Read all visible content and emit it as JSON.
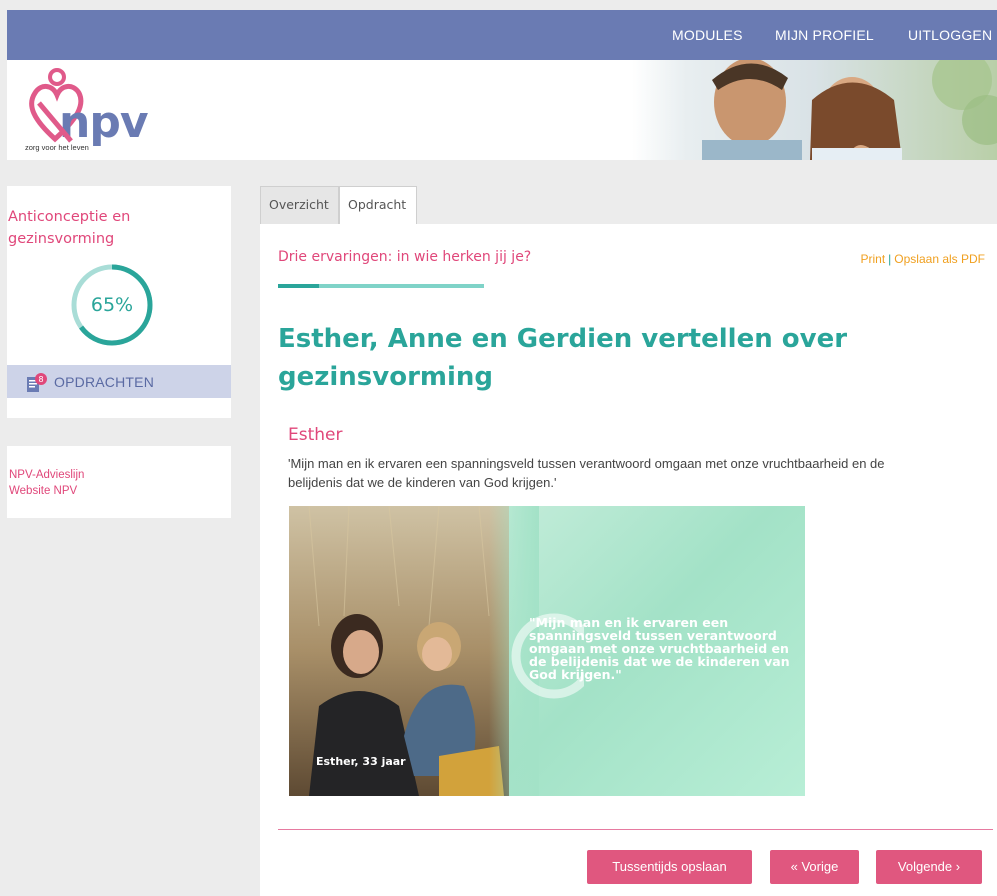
{
  "nav": {
    "modules": "MODULES",
    "profile": "MIJN PROFIEL",
    "logout": "UITLOGGEN"
  },
  "header": {
    "logo_text": "npv",
    "logo_tagline": "zorg voor het leven"
  },
  "sidebar": {
    "module_title": "Anticonceptie en gezinsvorming",
    "progress_percent": 65,
    "progress_label": "65%",
    "opdrachten_label": "OPDRACHTEN",
    "opdrachten_badge": "8",
    "links": [
      "NPV-Advieslijn",
      "Website NPV"
    ]
  },
  "tabs": [
    "Overzicht",
    "Opdracht"
  ],
  "main": {
    "exercise_title": "Drie ervaringen: in wie herken jij je?",
    "print_label": "Print",
    "pdf_label": "Opslaan als PDF",
    "step_progress": 0.2,
    "heading": "Esther, Anne en Gerdien vertellen over gezinsvorming",
    "person_name": "Esther",
    "quote": "'Mijn man en ik ervaren een spanningsveld tussen verantwoord omgaan met onze vruchtbaarheid en de belijdenis dat we de kinderen van God krijgen.'",
    "photo_quote": "\"Mijn man en ik ervaren een spanningsveld tussen verantwoord omgaan met onze vruchtbaarheid en de belijdenis dat we de kinderen van God krijgen.\"",
    "photo_caption": "Esther, 33 jaar"
  },
  "buttons": {
    "save": "Tussentijds opslaan",
    "prev": "« Vorige",
    "next": "Volgende ›"
  },
  "colors": {
    "nav_bg": "#6a7bb3",
    "pink": "#e0477a",
    "teal": "#2aa59a",
    "button": "#e0577f"
  }
}
